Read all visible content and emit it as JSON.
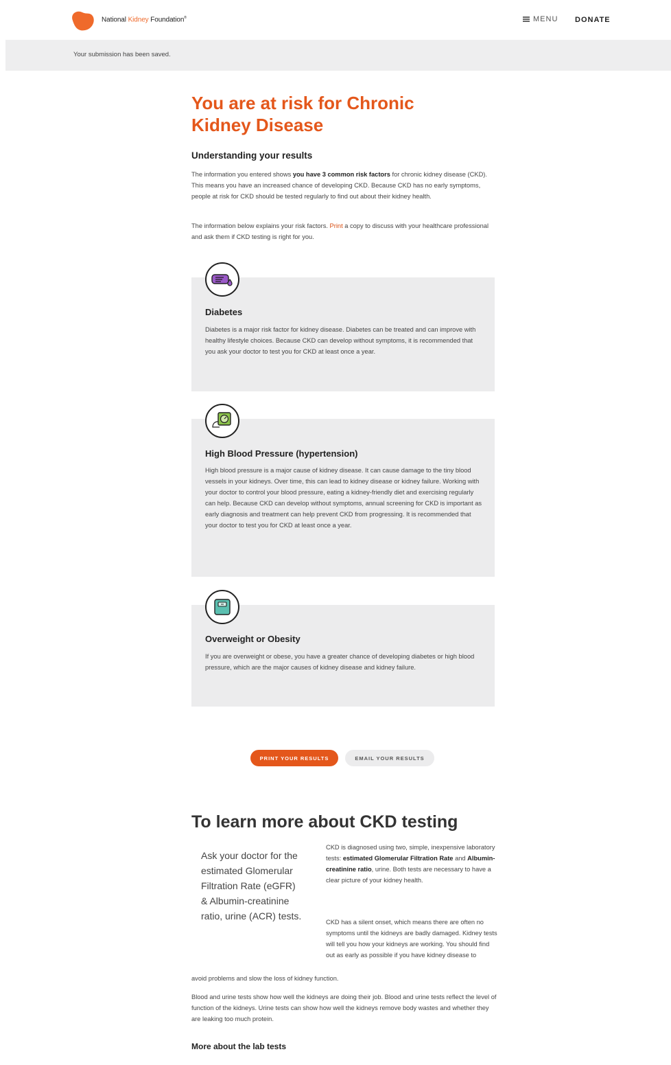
{
  "header": {
    "logo_prefix": "National ",
    "logo_accent": "Kidney",
    "logo_suffix": " Foundation",
    "logo_mark": "®",
    "menu_label": "MENU",
    "donate_label": "DONATE",
    "brand_color": "#ef6a2b"
  },
  "banner": {
    "text": "Your submission has been saved."
  },
  "results": {
    "title": "You are at risk for Chronic Kidney Disease",
    "subtitle": "Understanding your results",
    "intro_pre": "The information you entered shows ",
    "intro_bold": "you have 3 common risk factors",
    "intro_post": " for chronic kidney disease (CKD). This means you have an increased chance of developing CKD. Because CKD has no early symptoms, people at risk for CKD should be tested regularly to find out about their kidney health.",
    "print_pre": "The information below explains your risk factors. ",
    "print_link": "Print",
    "print_post": " a copy to discuss with your healthcare professional and ask them if CKD testing is right for you."
  },
  "risk_factors": [
    {
      "icon": "diabetes-icon",
      "title": "Diabetes",
      "body": "Diabetes is a major risk factor for kidney disease. Diabetes can be treated and can improve with healthy lifestyle choices. Because CKD can develop without symptoms, it is recommended that you ask your doctor to test you for CKD at least once a year."
    },
    {
      "icon": "blood-pressure-icon",
      "title": "High Blood Pressure (hypertension)",
      "body": "High blood pressure is a major cause of kidney disease. It can cause damage to the tiny blood vessels in your kidneys.  Over time, this can lead to kidney disease or kidney failure. Working with your doctor to control your blood pressure, eating a kidney-friendly diet and exercising regularly can help. Because CKD can develop without symptoms, annual screening for CKD is important as early diagnosis and treatment can help prevent CKD from progressing. It is recommended that your doctor to test you for CKD at least once a year."
    },
    {
      "icon": "scale-icon",
      "title": "Overweight or Obesity",
      "body": "If you are overweight or obese, you have a greater chance of developing diabetes or high blood pressure, which are the major causes of kidney disease and kidney failure."
    }
  ],
  "actions": {
    "print_label": "PRINT YOUR RESULTS",
    "email_label": "EMAIL YOUR RESULTS",
    "accent": "#e4571b"
  },
  "learn_more": {
    "title": "To learn more about CKD testing",
    "ask": "Ask your doctor for the estimated Glomerular Filtration Rate (eGFR) & Albumin-creatinine ratio, urine (ACR) tests.",
    "p1_pre": "CKD is diagnosed using two, simple, inexpensive laboratory tests: ",
    "p1_bold1": "estimated Glomerular Filtration Rate",
    "p1_mid": " and ",
    "p1_bold2": "Albumin-creatinine ratio",
    "p1_post": ", urine. Both tests are necessary to have a clear picture of your kidney health.",
    "p2_wrap": "CKD has a silent onset, which means there are often no symptoms until the kidneys are badly damaged. Kidney tests will tell you how your kidneys are working. You should find out as early as possible if you have kidney disease to",
    "p2_tail": "avoid problems and slow the loss of kidney function.",
    "p3": "Blood and urine tests show how well the kidneys are doing their job. Blood and urine tests reflect the level of function of the kidneys. Urine tests can show how well the kidneys remove body wastes and whether they are leaking too much protein.",
    "more_heading": "More about the lab tests"
  }
}
